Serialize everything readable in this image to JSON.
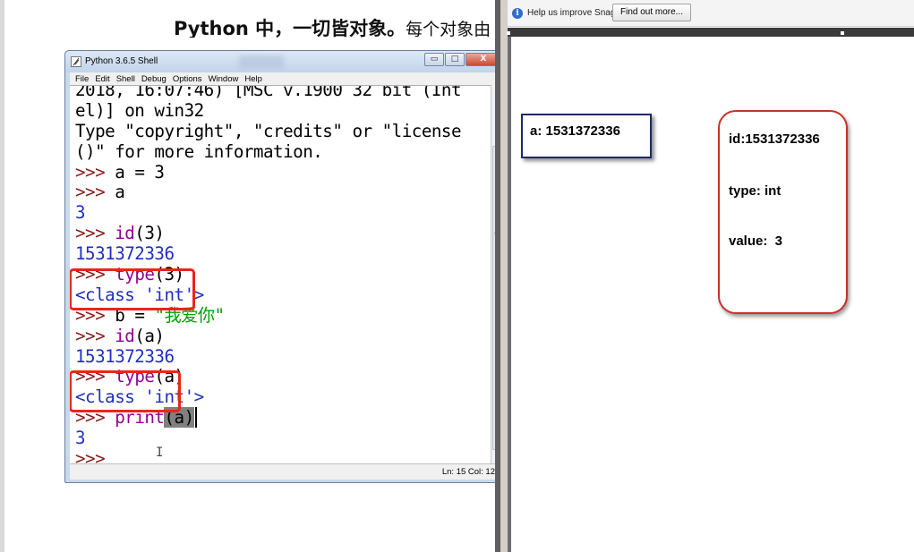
{
  "slide": {
    "heading_bold": "Python 中，一切皆对象。",
    "heading_normal": "每个对象由"
  },
  "shell": {
    "title": "Python 3.6.5 Shell",
    "window_buttons": {
      "minimize": "▭",
      "maximize": "□",
      "close": "X"
    },
    "menu": [
      "File",
      "Edit",
      "Shell",
      "Debug",
      "Options",
      "Window",
      "Help"
    ],
    "lines": [
      [
        {
          "t": "2018, 16:07:46) [MSC v.1900 32 bit (Int",
          "c": "out"
        }
      ],
      [
        {
          "t": "el)] on win32",
          "c": "out"
        }
      ],
      [
        {
          "t": "Type \"copyright\", \"credits\" or \"license",
          "c": "out"
        }
      ],
      [
        {
          "t": "()\" for more information.",
          "c": "out"
        }
      ],
      [
        {
          "t": ">>> ",
          "c": "prompt"
        },
        {
          "t": "a = 3",
          "c": "out"
        }
      ],
      [
        {
          "t": ">>> ",
          "c": "prompt"
        },
        {
          "t": "a",
          "c": "out"
        }
      ],
      [
        {
          "t": "3",
          "c": "blue"
        }
      ],
      [
        {
          "t": ">>> ",
          "c": "prompt"
        },
        {
          "t": "id",
          "c": "builtin"
        },
        {
          "t": "(3)",
          "c": "out"
        }
      ],
      [
        {
          "t": "1531372336",
          "c": "blue"
        }
      ],
      [
        {
          "t": ">>> ",
          "c": "prompt"
        },
        {
          "t": "type",
          "c": "builtin"
        },
        {
          "t": "(3)",
          "c": "out"
        }
      ],
      [
        {
          "t": "<class 'int'>",
          "c": "blue"
        }
      ],
      [
        {
          "t": ">>> ",
          "c": "prompt"
        },
        {
          "t": "b = ",
          "c": "out"
        },
        {
          "t": "\"我爱你\"",
          "c": "string"
        }
      ],
      [
        {
          "t": ">>> ",
          "c": "prompt"
        },
        {
          "t": "id",
          "c": "builtin"
        },
        {
          "t": "(a)",
          "c": "out"
        }
      ],
      [
        {
          "t": "1531372336",
          "c": "blue"
        }
      ],
      [
        {
          "t": ">>> ",
          "c": "prompt"
        },
        {
          "t": "type",
          "c": "builtin"
        },
        {
          "t": "(a)",
          "c": "out"
        }
      ],
      [
        {
          "t": "<class 'int'>",
          "c": "blue"
        }
      ],
      [
        {
          "t": ">>> ",
          "c": "prompt"
        },
        {
          "t": "print",
          "c": "builtin"
        },
        {
          "t": "(a)",
          "c": "hl"
        }
      ],
      [
        {
          "t": "3",
          "c": "blue"
        }
      ],
      [
        {
          "t": ">>> ",
          "c": "prompt"
        }
      ]
    ],
    "status": "Ln: 15  Col: 12",
    "colors": {
      "prompt": "#8b1a1a",
      "output": "#1f2fbf",
      "builtin": "#900090",
      "string": "#00a000",
      "highlight_box": "#e8261a"
    }
  },
  "snagit": {
    "info_icon": "i",
    "message": "Help us improve Snagit",
    "button": "Find out more..."
  },
  "diagram": {
    "variable_label": "a: 1531372336",
    "object": {
      "id_line": "id:1531372336",
      "type_line": "type: int",
      "value_line": "value:  3"
    }
  }
}
